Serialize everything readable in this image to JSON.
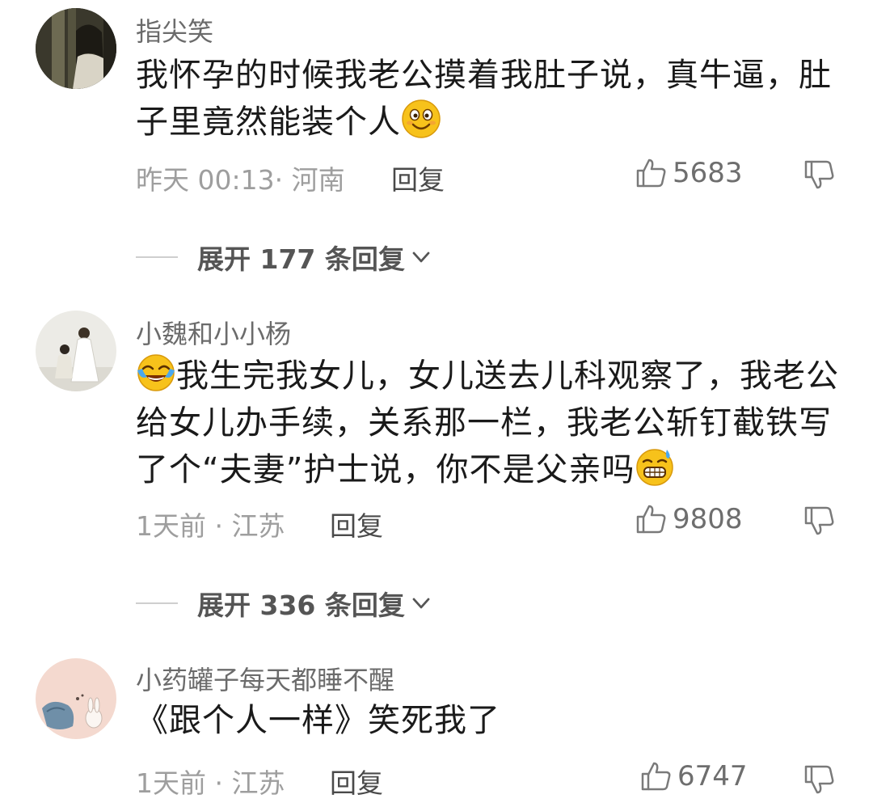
{
  "comments": [
    {
      "username": "指尖笑",
      "text_parts": [
        "我怀孕的时候我老公摸着我肚子说，真牛逼，肚子里竟然能装个人"
      ],
      "emoji_icon": "smile-emoji-icon",
      "meta": "昨天 00:13· 河南",
      "reply_label": "回复",
      "likes": "5683",
      "expand_label": "展开 177 条回复"
    },
    {
      "username": "小魏和小小杨",
      "text_lead_emoji": "crying-laughing-emoji-icon",
      "text": "我生完我女儿，女儿送去儿科观察了，我老公给女儿办手续，关系那一栏，我老公斩钉截铁写了个“夫妻”护士说，你不是父亲吗",
      "emoji_icon": "grin-sweat-emoji-icon",
      "meta": "1天前 · 江苏",
      "reply_label": "回复",
      "likes": "9808",
      "expand_label": "展开 336 条回复"
    },
    {
      "username": "小药罐子每天都睡不醒",
      "text": "《跟个人一样》笑死我了",
      "meta": "1天前 · 江苏",
      "reply_label": "回复",
      "likes": "6747"
    }
  ],
  "icons": {
    "like": "thumbs-up-icon",
    "dislike": "thumbs-down-icon",
    "chevron": "chevron-down-icon"
  },
  "colors": {
    "username": "#6b6b6b",
    "meta": "#9e9e9e",
    "emoji_yellow": "#f7c21b"
  }
}
